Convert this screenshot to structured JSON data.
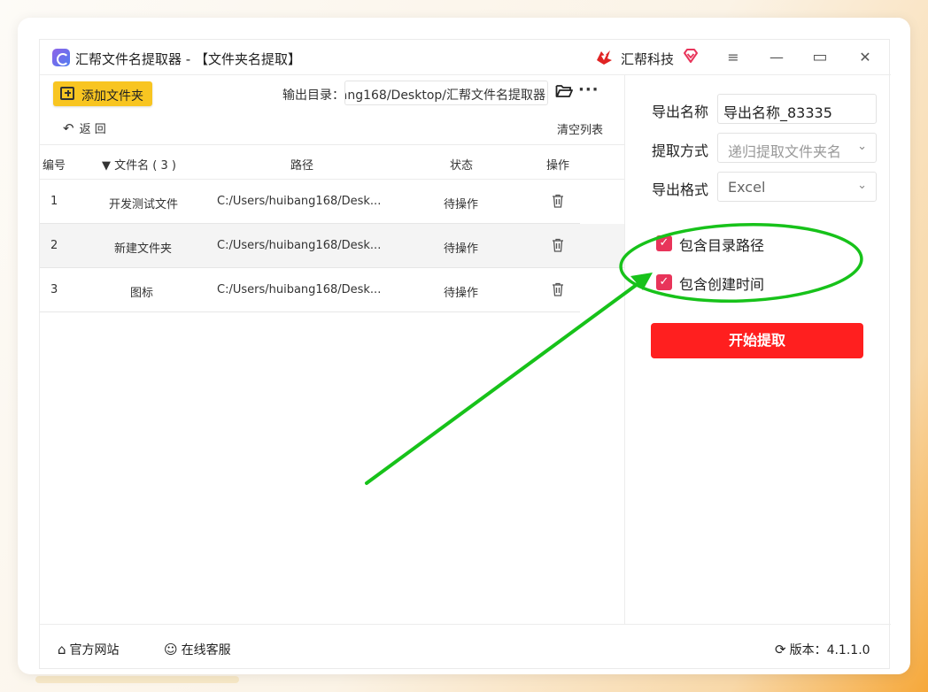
{
  "titlebar": {
    "app_title": "汇帮文件名提取器 - 【文件夹名提取】",
    "brand": "汇帮科技",
    "menu_glyph": "≡",
    "minimize_glyph": "—",
    "maximize_glyph": "▭",
    "close_glyph": "✕"
  },
  "toolbar": {
    "add_folder": "添加文件夹",
    "output_label": "输出目录：",
    "output_path": "ang168/Desktop/汇帮文件名提取器",
    "more_glyph": "···",
    "back": "返  回",
    "back_glyph": "↶",
    "clear": "清空列表"
  },
  "table": {
    "headers": {
      "index": "编号",
      "name": "▼ 文件名 ( 3 )",
      "path": "路径",
      "status": "状态",
      "action": "操作"
    },
    "rows": [
      {
        "index": "1",
        "name": "开发测试文件",
        "path": "C:/Users/huibang168/Desk...",
        "status": "待操作"
      },
      {
        "index": "2",
        "name": "新建文件夹",
        "path": "C:/Users/huibang168/Desk...",
        "status": "待操作"
      },
      {
        "index": "3",
        "name": "图标",
        "path": "C:/Users/huibang168/Desk...",
        "status": "待操作"
      }
    ]
  },
  "settings": {
    "export_name_label": "导出名称",
    "export_name_value": "导出名称_83335",
    "method_label": "提取方式",
    "method_value": "递归提取文件夹名",
    "format_label": "导出格式",
    "format_value": "Excel",
    "chevron": "⌄",
    "include_path": "包含目录路径",
    "include_time": "包含创建时间",
    "check_glyph": "✓",
    "start": "开始提取"
  },
  "footer": {
    "website": "官方网站",
    "support": "在线客服",
    "version": "版本：4.1.1.0",
    "home_glyph": "⌂",
    "support_glyph": "☺",
    "refresh_glyph": "⟳"
  },
  "colors": {
    "accent_yellow": "#f8c521",
    "start_red": "#ff1f1f",
    "check_pink": "#e8345a",
    "annotation_green": "#17c21a"
  }
}
